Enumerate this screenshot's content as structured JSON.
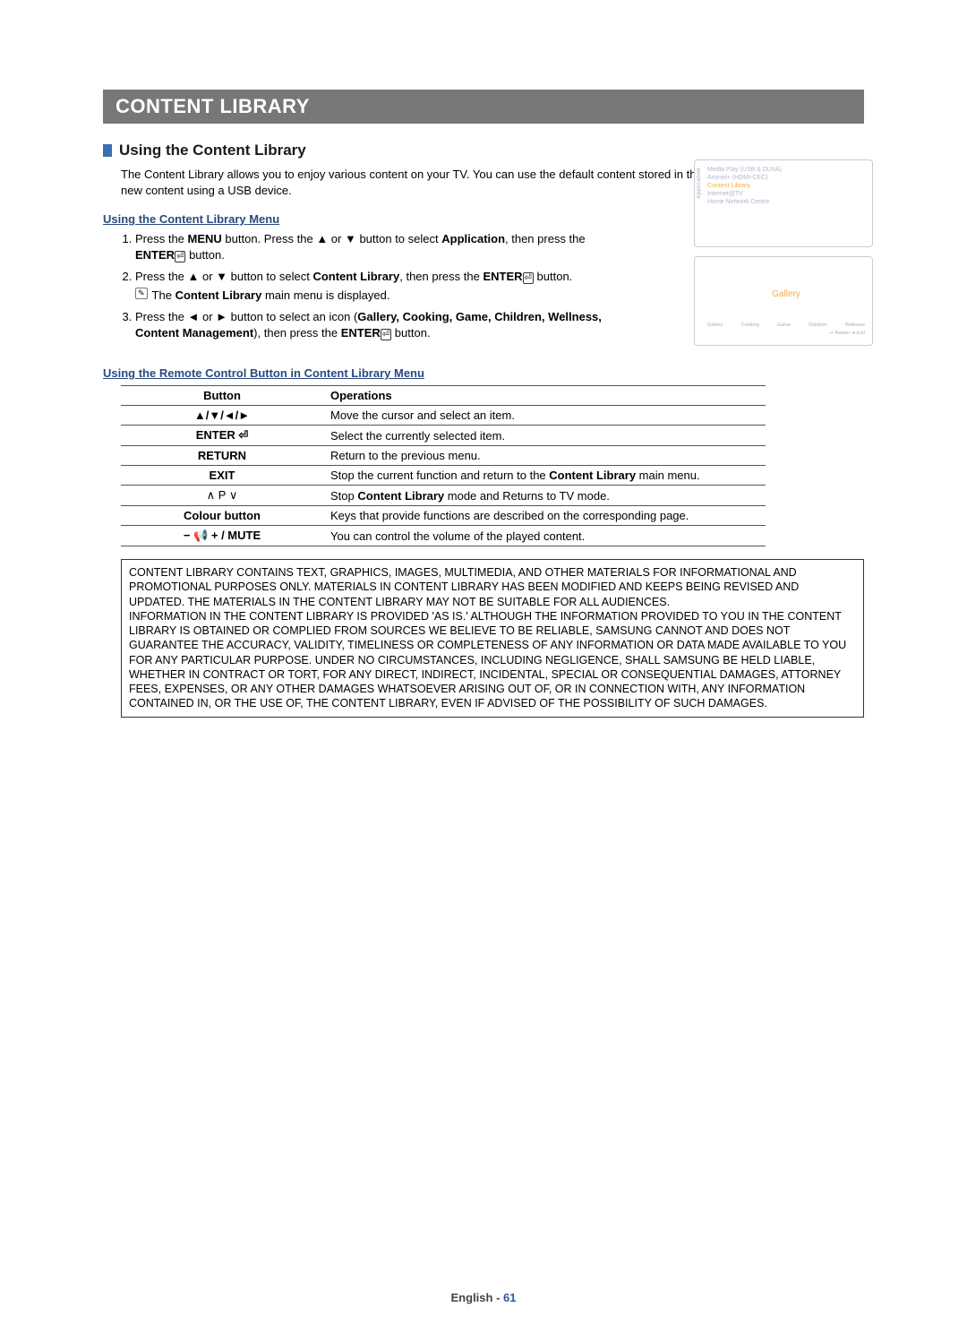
{
  "titleBar": "CONTENT LIBRARY",
  "section": {
    "heading": "Using the Content Library",
    "intro": "The Content Library allows you to enjoy various content on your TV. You can use the default content stored in the TV memory or you can enjoy new content using a USB device.",
    "sub1": "Using the Content Library Menu",
    "steps": {
      "s1a": "Press the ",
      "s1_menu": "MENU",
      "s1b": " button. Press the ▲ or ▼ button to select ",
      "s1_app": "Application",
      "s1c": ", then press the ",
      "s1_enter": "ENTER",
      "s1d": " button.",
      "s2a": "Press the ▲ or ▼ button to select ",
      "s2_cl": "Content Library",
      "s2b": ", then press the ",
      "s2_enter": "ENTER",
      "s2c": " button.",
      "s2_note": "The ",
      "s2_note_b": "Content Library",
      "s2_note_c": " main menu is displayed.",
      "s3a": "Press the ◄ or ► button to select an icon (",
      "s3_list": "Gallery, Cooking, Game, Children, Wellness, Content Management",
      "s3b": "), then press the ",
      "s3_enter": "ENTER",
      "s3c": " button."
    },
    "sub2": "Using the Remote Control Button in Content Library Menu",
    "table": {
      "head_btn": "Button",
      "head_op": "Operations",
      "rows": [
        {
          "btn": "▲/▼/◄/►",
          "op": "Move the cursor and select an item."
        },
        {
          "btn": "ENTER ⏎",
          "op": "Select the currently selected item."
        },
        {
          "btn": "RETURN",
          "op": "Return to the previous menu."
        },
        {
          "btn": "EXIT",
          "op_a": "Stop the current function and return to the ",
          "op_b": "Content Library",
          "op_c": " main menu."
        },
        {
          "btn": "∧ P ∨",
          "op_a": "Stop ",
          "op_b": "Content Library",
          "op_c": " mode and Returns to TV mode."
        },
        {
          "btn": "Colour button",
          "op": "Keys that provide functions are described on the corresponding page."
        },
        {
          "btn": "− 📢 + / MUTE",
          "op": "You can control the volume of the played content."
        }
      ]
    },
    "disclaimer": "CONTENT LIBRARY CONTAINS TEXT, GRAPHICS, IMAGES, MULTIMEDIA, AND OTHER MATERIALS FOR INFORMATIONAL AND PROMOTIONAL PURPOSES ONLY. MATERIALS IN CONTENT LIBRARY HAS BEEN MODIFIED AND KEEPS BEING REVISED AND UPDATED. THE MATERIALS IN THE CONTENT LIBRARY MAY NOT BE SUITABLE FOR ALL AUDIENCES.\nINFORMATION IN THE CONTENT LIBRARY IS PROVIDED 'AS IS.' ALTHOUGH THE INFORMATION PROVIDED TO YOU IN THE CONTENT LIBRARY IS OBTAINED OR COMPLIED FROM SOURCES WE BELIEVE TO BE RELIABLE, SAMSUNG CANNOT AND DOES NOT GUARANTEE THE ACCURACY, VALIDITY, TIMELINESS OR COMPLETENESS OF ANY INFORMATION OR DATA MADE AVAILABLE TO YOU FOR ANY PARTICULAR PURPOSE. UNDER NO CIRCUMSTANCES, INCLUDING NEGLIGENCE, SHALL SAMSUNG BE HELD LIABLE, WHETHER IN CONTRACT OR TORT, FOR ANY DIRECT, INDIRECT, INCIDENTAL, SPECIAL OR CONSEQUENTIAL DAMAGES, ATTORNEY FEES, EXPENSES, OR ANY OTHER DAMAGES WHATSOEVER ARISING OUT OF, OR IN CONNECTION WITH, ANY INFORMATION CONTAINED IN, OR THE USE OF, THE CONTENT LIBRARY, EVEN IF ADVISED OF THE POSSIBILITY OF SUCH DAMAGES."
  },
  "screenshot1": {
    "vtab": "Application",
    "items": [
      "Media Play (USB & DLNA)",
      "Anynet+ (HDMI-CEC)",
      "Content Library",
      "Internet@TV",
      "Home Network Centre"
    ],
    "selected_index": 2
  },
  "screenshot2": {
    "title": "Gallery",
    "row": [
      "Gallery",
      "Cooking",
      "Game",
      "Children",
      "Wellness"
    ],
    "footer": "↩ Return  ➔ Exit"
  },
  "footer": {
    "lang": "English - ",
    "page": "61"
  }
}
